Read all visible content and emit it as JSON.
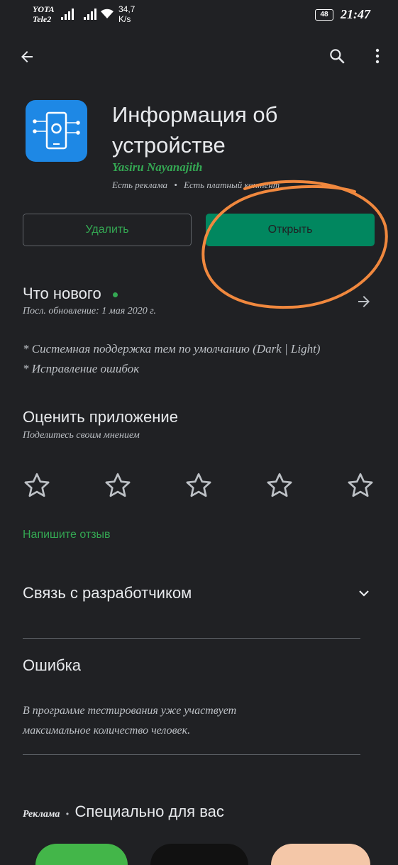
{
  "status_bar": {
    "carrier_1": "YOTA",
    "carrier_2": "Tele2",
    "speed_value": "34,7",
    "speed_unit": "K/s",
    "battery": "48",
    "time": "21:47"
  },
  "app": {
    "title_line1": "Информация об",
    "title_line2": "устройстве",
    "developer": "Yasiru Nayanajith",
    "ads_label": "Есть реклама",
    "separator": "•",
    "paid_label": "Есть платный контент"
  },
  "buttons": {
    "uninstall": "Удалить",
    "open": "Открыть"
  },
  "whats_new": {
    "title": "Что нового",
    "updated": "Посл. обновление: 1 мая 2020 г.",
    "line1": "* Системная поддержка тем по умолчанию (Dark | Light)",
    "line2": "* Исправление ошибок"
  },
  "rate": {
    "title": "Оценить приложение",
    "subtitle": "Поделитесь своим мнением",
    "star_count": 5,
    "write_review": "Напишите отзыв"
  },
  "developer_contact": {
    "title": "Связь с разработчиком"
  },
  "error": {
    "title": "Ошибка",
    "line1": "В программе тестирования уже участвует",
    "line2": "максимальное количество человек."
  },
  "ads_section": {
    "label": "Реклама",
    "separator": "•",
    "title": "Специально для вас"
  },
  "colors": {
    "background": "#202124",
    "accent_green": "#01875f",
    "link_green": "#34a853",
    "annotation_orange": "#f0883e",
    "icon_blue": "#1e88e5"
  }
}
